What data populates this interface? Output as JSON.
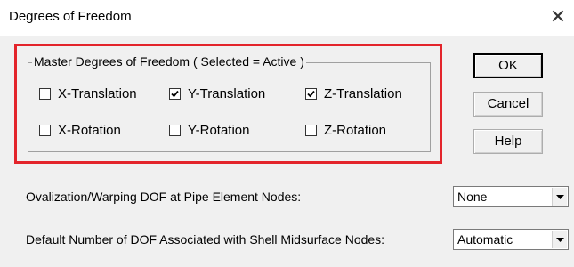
{
  "window": {
    "title": "Degrees of Freedom",
    "close_glyph": "✕"
  },
  "group": {
    "legend": "Master Degrees of Freedom ( Selected = Active )",
    "highlight_color": "#e3242b",
    "checkboxes": [
      {
        "label": "X-Translation",
        "checked": false
      },
      {
        "label": "Y-Translation",
        "checked": true
      },
      {
        "label": "Z-Translation",
        "checked": true
      },
      {
        "label": "X-Rotation",
        "checked": false
      },
      {
        "label": "Y-Rotation",
        "checked": false
      },
      {
        "label": "Z-Rotation",
        "checked": false
      }
    ]
  },
  "buttons": {
    "ok": "OK",
    "cancel": "Cancel",
    "help": "Help"
  },
  "settings": {
    "ovalization_label": "Ovalization/Warping DOF at Pipe Element Nodes:",
    "ovalization_value": "None",
    "shell_label": "Default Number of DOF Associated with Shell Midsurface Nodes:",
    "shell_value": "Automatic"
  }
}
